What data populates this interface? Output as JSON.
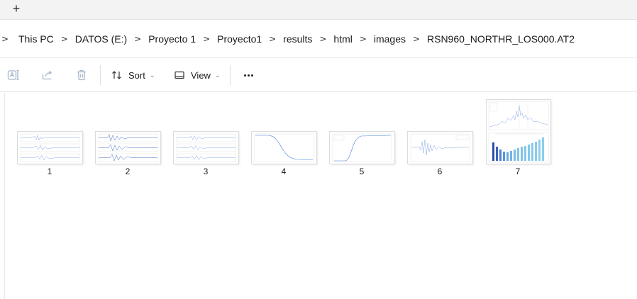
{
  "tabs": {
    "new_tab_label": "+"
  },
  "breadcrumb": {
    "items": [
      "This PC",
      "DATOS (E:)",
      "Proyecto 1",
      "Proyecto1",
      "results",
      "html",
      "images",
      "RSN960_NORTHR_LOS000.AT2"
    ],
    "separator": ">"
  },
  "toolbar": {
    "rename_icon": "rename-icon",
    "share_icon": "share-icon",
    "delete_icon": "trash-icon",
    "sort_label": "Sort",
    "view_label": "View",
    "more_icon": "ellipsis-icon"
  },
  "files": [
    {
      "label": "1",
      "kind": "three-panel-timeseries"
    },
    {
      "label": "2",
      "kind": "three-panel-timeseries"
    },
    {
      "label": "3",
      "kind": "three-panel-timeseries"
    },
    {
      "label": "4",
      "kind": "decay-curve"
    },
    {
      "label": "5",
      "kind": "growth-curve"
    },
    {
      "label": "6",
      "kind": "accelerogram"
    },
    {
      "label": "7",
      "kind": "spectrum-and-bars"
    }
  ],
  "colors": {
    "accent": "#4a7fd6",
    "bar_dark": "#2b4fa8",
    "bar_light": "#7fc4e8"
  }
}
